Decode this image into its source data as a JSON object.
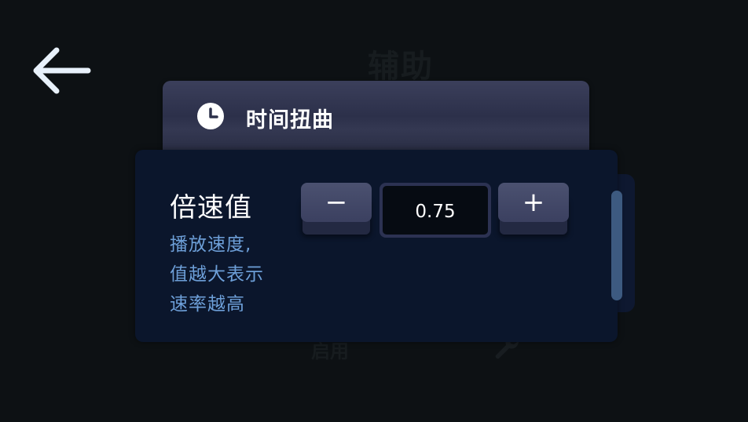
{
  "background": {
    "title": "辅助",
    "enable_label": "启用"
  },
  "header": {
    "title": "时间扭曲",
    "icon": "clock-icon"
  },
  "setting": {
    "title": "倍速值",
    "description_lines": [
      "播放速度,",
      "值越大表示",
      "速率越高"
    ],
    "value": "0.75",
    "minus_label": "−",
    "plus_label": "+"
  },
  "colors": {
    "background": "#0d1114",
    "panel": "#0b162c",
    "header_card": "#2c304a",
    "description_text": "#6d9fd8",
    "button": "#4b5170",
    "scrollbar": "#3d5a80"
  }
}
